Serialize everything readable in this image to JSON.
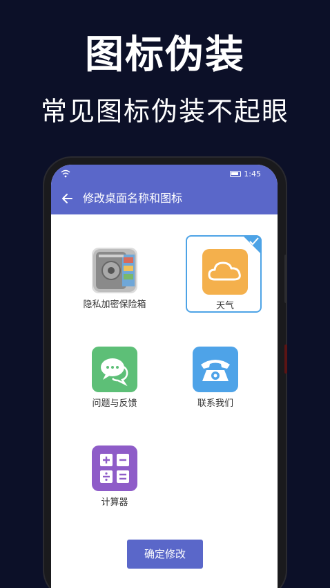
{
  "promo": {
    "headline": "图标伪装",
    "subline": "常见图标伪装不起眼"
  },
  "statusbar": {
    "time": "1:45",
    "icons": [
      "wifi-icon",
      "battery-icon"
    ]
  },
  "appbar": {
    "back_icon": "back-arrow-icon",
    "title": "修改桌面名称和图标"
  },
  "icons": [
    {
      "name": "safe-icon",
      "label": "隐私加密保险箱",
      "selected": false
    },
    {
      "name": "weather-icon",
      "label": "天气",
      "selected": true,
      "color": "#f4b04c"
    },
    {
      "name": "chat-icon",
      "label": "问题与反馈",
      "selected": false,
      "color": "#5dbf77"
    },
    {
      "name": "phone-icon",
      "label": "联系我们",
      "selected": false,
      "color": "#4ea3e8"
    },
    {
      "name": "calculator-icon",
      "label": "计算器",
      "selected": false,
      "color": "#8e5cc8"
    }
  ],
  "confirm_label": "确定修改",
  "colors": {
    "background": "#0c1028",
    "accent": "#5a67c9",
    "selected_border": "#4da3e6"
  }
}
